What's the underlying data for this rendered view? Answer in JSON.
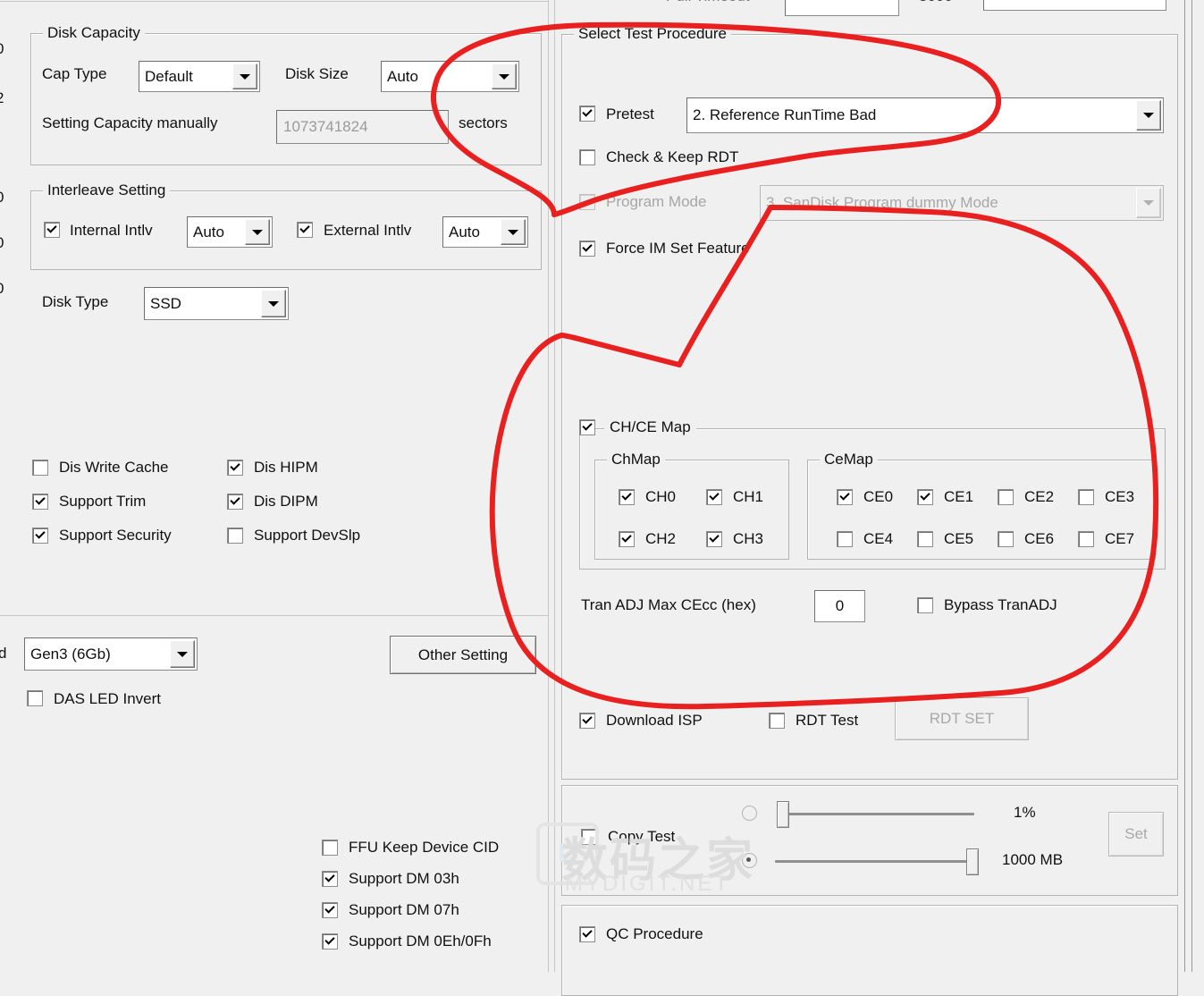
{
  "left_panel": {
    "edge_numbers": [
      "0",
      "2",
      "0",
      "0",
      "0"
    ],
    "disk_capacity": {
      "title": "Disk Capacity",
      "cap_type_label": "Cap Type",
      "cap_type_value": "Default",
      "disk_size_label": "Disk Size",
      "disk_size_value": "Auto",
      "setting_capacity_label": "Setting Capacity manually",
      "setting_capacity_value": "1073741824",
      "sectors_label": "sectors"
    },
    "interleave": {
      "title": "Interleave Setting",
      "internal_label": "Internal Intlv",
      "internal_checked": true,
      "internal_value": "Auto",
      "external_label": "External Intlv",
      "external_checked": true,
      "external_value": "Auto"
    },
    "disk_type_label": "Disk Type",
    "disk_type_value": "SSD",
    "feature_checkboxes": [
      {
        "label": "Dis Write Cache",
        "checked": false
      },
      {
        "label": "Dis HIPM",
        "checked": true
      },
      {
        "label": "Support Trim",
        "checked": true
      },
      {
        "label": "Dis DIPM",
        "checked": true
      },
      {
        "label": "Support Security",
        "checked": true
      },
      {
        "label": "Support DevSlp",
        "checked": false
      }
    ],
    "speed_prefix_label": "d",
    "speed_value": "Gen3 (6Gb)",
    "other_setting_button": "Other Setting",
    "das_led_invert": {
      "label": "DAS LED Invert",
      "checked": false
    },
    "dm_checkboxes": [
      {
        "label": "FFU Keep Device CID",
        "checked": false
      },
      {
        "label": "Support DM 03h",
        "checked": true
      },
      {
        "label": "Support DM 07h",
        "checked": true
      },
      {
        "label": "Support DM 0Eh/0Fh",
        "checked": true
      }
    ]
  },
  "right_panel": {
    "select_test_procedure": {
      "title": "Select Test Procedure",
      "pretest": {
        "label": "Pretest",
        "checked": true,
        "value": "2. Reference RunTime Bad"
      },
      "check_keep_rdt": {
        "label": "Check & Keep RDT",
        "checked": false
      },
      "program_mode": {
        "label": "Program Mode",
        "checked": false,
        "disabled": true,
        "value": "3. SanDisk Program dummy Mode"
      },
      "force_im": {
        "label": "Force IM Set Feature",
        "checked": true
      },
      "chce_map": {
        "label": "CH/CE Map",
        "checked": true,
        "chmap": {
          "title": "ChMap",
          "items": [
            {
              "label": "CH0",
              "checked": true
            },
            {
              "label": "CH1",
              "checked": true
            },
            {
              "label": "CH2",
              "checked": true
            },
            {
              "label": "CH3",
              "checked": true
            }
          ]
        },
        "cemap": {
          "title": "CeMap",
          "items": [
            {
              "label": "CE0",
              "checked": true
            },
            {
              "label": "CE1",
              "checked": true
            },
            {
              "label": "CE2",
              "checked": false
            },
            {
              "label": "CE3",
              "checked": false
            },
            {
              "label": "CE4",
              "checked": false
            },
            {
              "label": "CE5",
              "checked": false
            },
            {
              "label": "CE6",
              "checked": false
            },
            {
              "label": "CE7",
              "checked": false
            }
          ]
        }
      },
      "tran_adj_label": "Tran ADJ Max CEcc (hex)",
      "tran_adj_value": "0",
      "bypass_tranadj": {
        "label": "Bypass TranADJ",
        "checked": false
      },
      "download_isp": {
        "label": "Download ISP",
        "checked": true
      },
      "rdt_test": {
        "label": "RDT Test",
        "checked": false
      },
      "rdt_set_button": "RDT SET"
    },
    "copy_test": {
      "label": "Copy Test",
      "checked": false,
      "percent_value": "1%",
      "percent_selected": false,
      "size_value": "1000 MB",
      "size_selected": true,
      "set_button": "Set"
    },
    "qc_procedure": {
      "label": "QC Procedure",
      "checked": true
    }
  },
  "watermark": {
    "cn": "数码之家",
    "en": "MYDIGIT.NET",
    "logo": "D"
  },
  "annotation": {
    "color": "#e8201f",
    "stroke_width": 6
  }
}
